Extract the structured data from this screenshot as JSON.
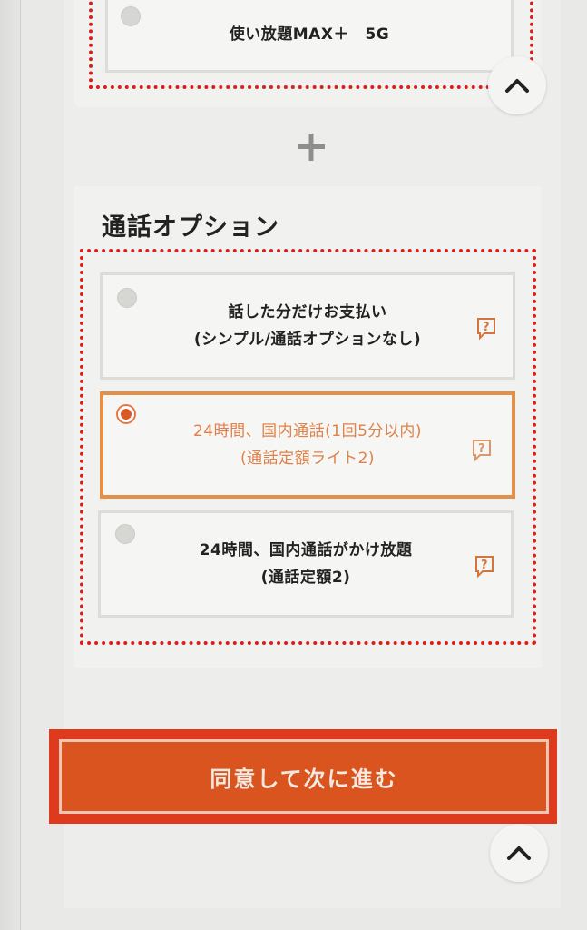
{
  "plan": {
    "selected_option_label": "使い放題MAX＋　5G"
  },
  "call_option": {
    "title": "通話オプション",
    "options": [
      {
        "line1": "話した分だけお支払い",
        "line2": "(シンプル/通話オプションなし)",
        "selected": false
      },
      {
        "line1": "24時間、国内通話(1回5分以内)",
        "line2": "(通話定額ライト2)",
        "selected": true
      },
      {
        "line1": "24時間、国内通話がかけ放題",
        "line2": "(通話定額2)",
        "selected": false
      }
    ]
  },
  "cta": {
    "label": "同意して次に進む"
  },
  "icons": {
    "help": "question-bubble-icon",
    "scroll": "chevron-up-icon",
    "plus": "plus-icon"
  },
  "colors": {
    "accent_red": "#d8201a",
    "accent_orange": "#d9541f",
    "selected_border": "#e39148"
  }
}
